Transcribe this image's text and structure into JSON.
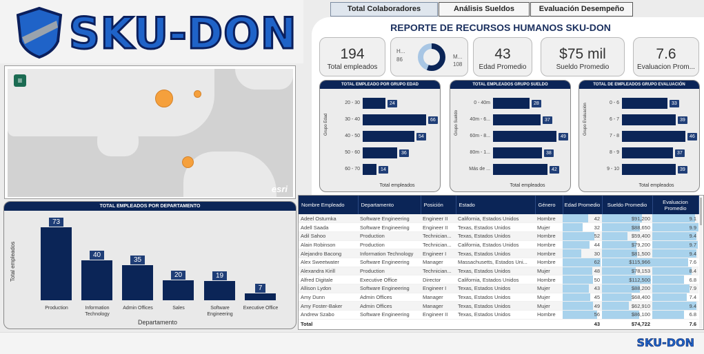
{
  "brand": {
    "name": "SKU-DON",
    "primary": "#0b2557",
    "accent": "#1f63c8",
    "bar_highlight": "#a8d2ec"
  },
  "tabs": [
    "Total Colaboradores",
    "Análisis Sueldos",
    "Evaluación Desempeño"
  ],
  "report_title": "REPORTE DE RECURSOS HUMANOS SKU-DON",
  "kpis": {
    "total_empleados": {
      "value": "194",
      "label": "Total empleados"
    },
    "gender_donut": {
      "left_label": "H...",
      "left_value": "86",
      "right_label": "M...",
      "right_value": "108",
      "hombres": 86,
      "mujeres": 108
    },
    "edad": {
      "value": "43",
      "label": "Edad Promedio"
    },
    "sueldo": {
      "value": "$75 mil",
      "label": "Sueldo Promedio"
    },
    "evaluacion": {
      "value": "7.6",
      "label": "Evaluacion Prom..."
    }
  },
  "chart_data": [
    {
      "type": "bar",
      "title": "TOTAL EMPLEADO POR GRUPO EDAD",
      "ylabel": "Grupo Edad",
      "xlabel": "Total empleados",
      "categories": [
        "20 - 30",
        "30 - 40",
        "40 - 50",
        "50 - 60",
        "60 - 70"
      ],
      "values": [
        24,
        66,
        54,
        36,
        14
      ]
    },
    {
      "type": "bar",
      "title": "TOTAL EMPLEADOS GRUPO SUELDO",
      "ylabel": "Grupo Sueldo",
      "xlabel": "Total empleados",
      "categories": [
        "0 - 40m",
        "40m - 6...",
        "60m - 8...",
        "80m - 1...",
        "Más de ..."
      ],
      "values": [
        28,
        37,
        49,
        38,
        42
      ]
    },
    {
      "type": "bar",
      "title": "TOTAL DE EMPLEADOS GRUPO EVALUACIÓN",
      "ylabel": "Grupo Evaluación",
      "xlabel": "Total empleados",
      "categories": [
        "0 - 6",
        "6 - 7",
        "7 - 8",
        "8 - 9",
        "9 - 10"
      ],
      "values": [
        33,
        39,
        46,
        37,
        39
      ]
    },
    {
      "type": "bar",
      "title": "TOTAL EMPLEADOS POR DEPARTAMENTO",
      "ylabel": "Total empleados",
      "xlabel": "Departamento",
      "categories": [
        "Production",
        "Information Technology",
        "Admin Offices",
        "Sales",
        "Software Engineering",
        "Executive Office"
      ],
      "values": [
        73,
        40,
        35,
        20,
        19,
        7
      ]
    }
  ],
  "map": {
    "attribution": "esri",
    "menu_icon": "hamburger-icon"
  },
  "table": {
    "headers": [
      "Nombre Empleado",
      "Departamento",
      "Posición",
      "Estado",
      "Género",
      "Edad Promedio",
      "Sueldo Promedio",
      "Evaluacion Promedio"
    ],
    "rows": [
      [
        "Adeel Osturnka",
        "Software Engineering",
        "Engineer II",
        "California, Estados Unidos",
        "Hombre",
        "42",
        "$91,200",
        "9.1"
      ],
      [
        "Adell Saada",
        "Software Engineering",
        "Engineer II",
        "Texas, Estados Unidos",
        "Mujer",
        "32",
        "$88,650",
        "9.9"
      ],
      [
        "Adil Sahoo",
        "Production",
        "Technician...",
        "Texas, Estados Unidos",
        "Hombre",
        "52",
        "$59,400",
        "9.4"
      ],
      [
        "Alain Robinson",
        "Production",
        "Technician...",
        "California, Estados Unidos",
        "Hombre",
        "44",
        "$79,200",
        "9.7"
      ],
      [
        "Alejandro Bacong",
        "Information Technology",
        "Engineer I",
        "Texas, Estados Unidos",
        "Hombre",
        "30",
        "$81,500",
        "9.4"
      ],
      [
        "Alex Sweetwater",
        "Software Engineering",
        "Manager",
        "Massachusetts, Estados Uni...",
        "Hombre",
        "62",
        "$115,966",
        "7.6"
      ],
      [
        "Alexandra Kirill",
        "Production",
        "Technician...",
        "Texas, Estados Unidos",
        "Mujer",
        "48",
        "$78,153",
        "8.4"
      ],
      [
        "Alfred Digitale",
        "Executive Office",
        "Director",
        "California, Estados Unidos",
        "Hombre",
        "50",
        "$112,500",
        "6.8"
      ],
      [
        "Allison Lydon",
        "Software Engineering",
        "Engineer I",
        "Texas, Estados Unidos",
        "Mujer",
        "43",
        "$88,200",
        "7.9"
      ],
      [
        "Amy Dunn",
        "Admin Offices",
        "Manager",
        "Texas, Estados Unidos",
        "Mujer",
        "45",
        "$68,400",
        "7.4"
      ],
      [
        "Amy Foster-Baker",
        "Admin Offices",
        "Manager",
        "Texas, Estados Unidos",
        "Mujer",
        "49",
        "$62,910",
        "9.4"
      ],
      [
        "Andrew Szabo",
        "Software Engineering",
        "Engineer II",
        "Texas, Estados Unidos",
        "Hombre",
        "56",
        "$86,100",
        "6.8"
      ]
    ],
    "bar_fractions": [
      [
        0.65,
        0.79,
        0.92
      ],
      [
        0.5,
        0.76,
        1.0
      ],
      [
        0.81,
        0.51,
        0.95
      ],
      [
        0.69,
        0.68,
        0.98
      ],
      [
        0.47,
        0.7,
        0.95
      ],
      [
        0.97,
        1.0,
        0.77
      ],
      [
        0.75,
        0.67,
        0.85
      ],
      [
        0.78,
        0.97,
        0.69
      ],
      [
        0.67,
        0.76,
        0.8
      ],
      [
        0.7,
        0.59,
        0.75
      ],
      [
        0.77,
        0.54,
        0.95
      ],
      [
        0.88,
        0.74,
        0.69
      ]
    ],
    "total": {
      "label": "Total",
      "edad": "43",
      "sueldo": "$74,722",
      "evaluacion": "7.6"
    }
  },
  "footer": {
    "logo_text": "SKU-DON"
  }
}
